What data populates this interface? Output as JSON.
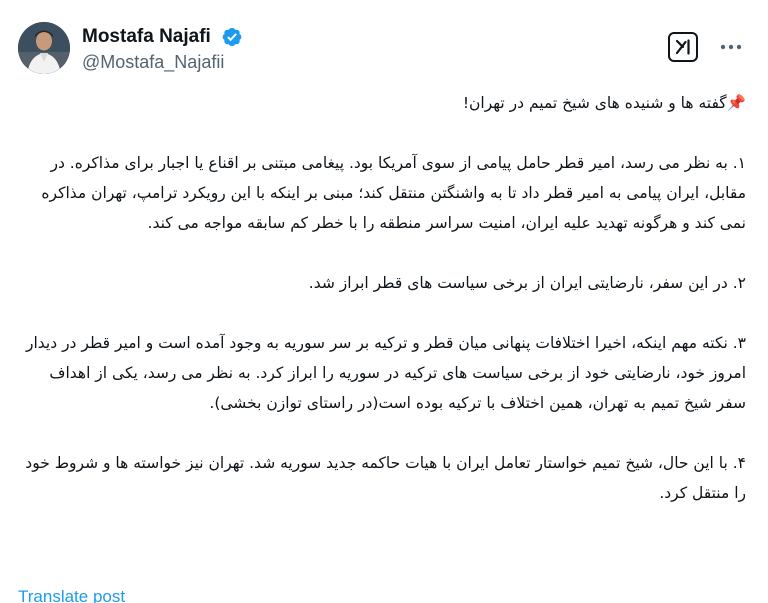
{
  "author": {
    "display_name": "Mostafa Najafi",
    "handle": "@Mostafa_Najafii",
    "verified": true
  },
  "header_icons": {
    "grok": "grok-icon",
    "more": "more-dots-icon"
  },
  "post": {
    "pin_emoji": "📌",
    "title": "گفته ها و شنیده های شیخ تمیم در تهران!",
    "paragraphs": [
      "۱. به نظر می رسد، امیر قطر حامل پیامی از سوی آمریکا بود. پیغامی مبتنی بر اقناع یا اجبار برای مذاکره. در مقابل، ایران پیامی به امیر قطر داد تا به واشنگتن منتقل کند؛ مبنی بر اینکه با این رویکرد ترامپ، تهران مذاکره نمی کند و هرگونه تهدید علیه ایران، امنیت سراسر منطقه را با خطر کم سابقه مواجه می کند.",
      "۲. در این سفر، نارضایتی ایران از برخی سیاست های قطر ابراز شد.",
      "۳. نکته مهم اینکه، اخیرا اختلافات پنهانی میان قطر و ترکیه بر سر سوریه به وجود آمده است و امیر قطر در دیدار امروز خود، نارضایتی خود از برخی سیاست های ترکیه در سوریه را ابراز کرد. به نظر می رسد، یکی از اهداف سفر شیخ تمیم به تهران، همین اختلاف با ترکیه بوده است(در راستای توازن بخشی).",
      "۴. با این حال، شیخ تمیم خواستار تعامل ایران با هیات حاکمه جدید سوریه شد. تهران نیز خواسته ها و شروط خود را منتقل کرد."
    ]
  },
  "footer": {
    "translate_label": "Translate post"
  },
  "colors": {
    "text": "#0f1419",
    "secondary": "#536471",
    "link": "#1d9bf0",
    "verified": "#1d9bf0"
  }
}
